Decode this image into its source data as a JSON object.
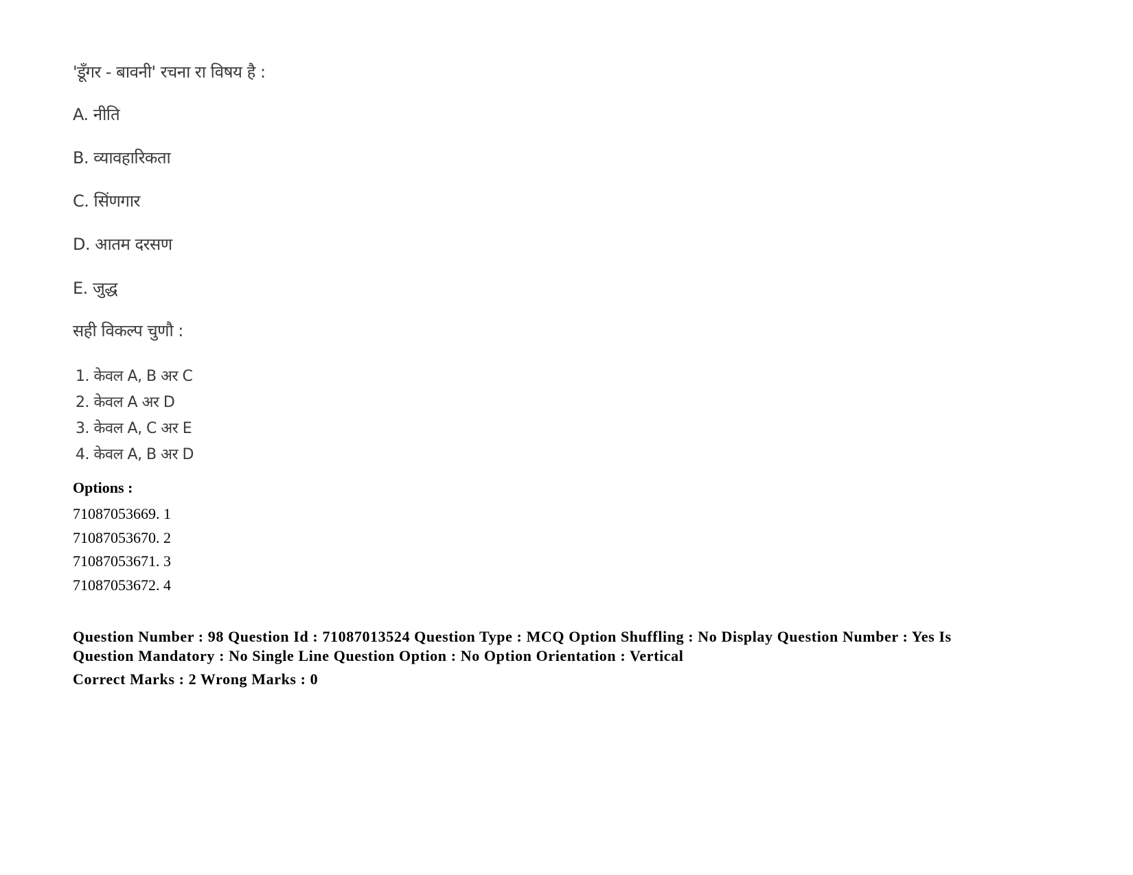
{
  "question": {
    "stem": "'डूँगर - बावनी' रचना रा विषय है :",
    "statements": [
      {
        "label": "A.",
        "text": "नीति"
      },
      {
        "label": "B.",
        "text": "व्यावहारिकता"
      },
      {
        "label": "C.",
        "text": "सिंणगार"
      },
      {
        "label": "D.",
        "text": "आतम दरसण"
      },
      {
        "label": "E.",
        "text": " जुद्ध"
      }
    ],
    "choose_prompt": "सही विकल्प चुणौ :",
    "choices": [
      "1. केवल A, B अर C",
      "2. केवल A अर D",
      "3. केवल A, C अर E",
      "4. केवल A, B अर D"
    ]
  },
  "options": {
    "label": "Options :",
    "items": [
      "71087053669. 1",
      "71087053670. 2",
      "71087053671. 3",
      "71087053672. 4"
    ]
  },
  "metadata": {
    "line1": "Question Number : 98 Question Id : 71087013524 Question Type : MCQ Option Shuffling : No Display Question Number : Yes Is",
    "line2": "Question Mandatory : No Single Line Question Option : No Option Orientation : Vertical",
    "line3": "Correct Marks : 2 Wrong Marks : 0"
  }
}
